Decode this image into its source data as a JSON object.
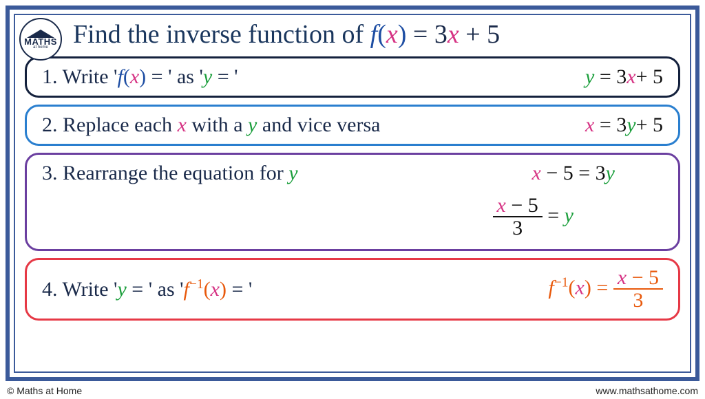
{
  "logo": {
    "main": "MATHS",
    "sub": "at home"
  },
  "title": {
    "lead": "Find the inverse function of ",
    "fx": "f",
    "paren_l": "(",
    "x": "x",
    "paren_r": ")",
    "eq": " = ",
    "coef": "3",
    "x2": "x",
    "plus5": " + 5"
  },
  "steps": {
    "s1": {
      "num": "1. ",
      "t1": "Write '",
      "fx": "f",
      "pl": "(",
      "x": "x",
      "pr": ")",
      "eq": " = ",
      "t2": "' as '",
      "y": "y",
      "eq2": " = ",
      "t3": "'",
      "rhs": {
        "y": "y",
        "eq": "  =  ",
        "coef": "3",
        "x": "x",
        "plus": "+ ",
        "five": "5"
      }
    },
    "s2": {
      "num": "2. ",
      "t1": "Replace each ",
      "x": "x",
      "t2": " with a ",
      "y": "y",
      "t3": " and vice versa",
      "rhs": {
        "x": "x",
        "eq": "  =  ",
        "coef": "3",
        "y": "y",
        "plus": "+ ",
        "five": "5"
      }
    },
    "s3": {
      "num": "3. ",
      "t1": "Rearrange the equation for ",
      "y": "y",
      "rhs1": {
        "x": "x",
        "minus5": " − 5",
        "eq": "  =  ",
        "coef": "3",
        "y2": "y"
      },
      "rhs2": {
        "num_x": "x",
        "num_m5": " − 5",
        "den": "3",
        "eq": " = ",
        "y": "y"
      }
    },
    "s4": {
      "num": "4. ",
      "t1": "Write '",
      "y": "y",
      "eq": " = ",
      "t2": "' as '",
      "f": "f",
      "inv": "−1",
      "pl": "(",
      "x": "x",
      "pr": ")",
      "eq2": " = ",
      "t3": "'",
      "rhs": {
        "f": "f",
        "inv": "−1",
        "pl": "(",
        "x": "x",
        "pr": ")",
        "eq": " = ",
        "num_x": "x",
        "num_m5": " − 5",
        "den": "3"
      }
    }
  },
  "footer": {
    "left": "© Maths at Home",
    "right": "www.mathsathome.com"
  }
}
